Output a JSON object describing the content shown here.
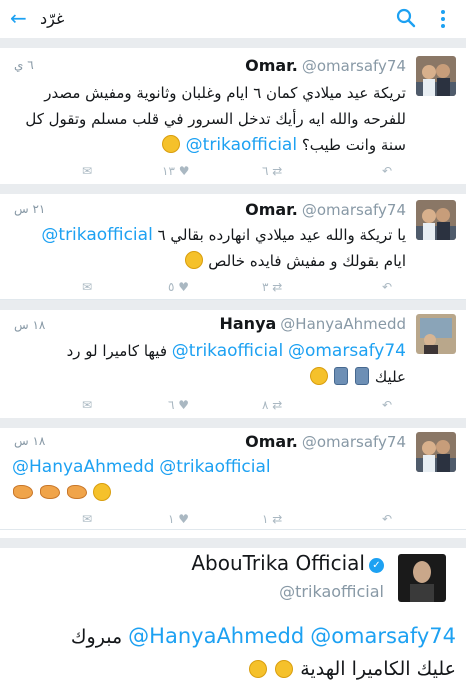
{
  "header": {
    "title": "غرّد"
  },
  "tweets": [
    {
      "name": "Omar.",
      "handle": "@omarsafy74",
      "time": "٦ ي",
      "line1": "تريكة عيد ميلادي كمان ٦ ايام وغلبان وثانوية ومفيش مصدر",
      "line2": "للفرحه والله ايه رأيك تدخل السرور في قلب مسلم وتقول كل",
      "line3": "سنة وانت طيب؟",
      "mention": "@trikaofficial",
      "reply": "",
      "retweets": "٦",
      "likes": "١٣"
    },
    {
      "name": "Omar.",
      "handle": "@omarsafy74",
      "time": "٢١ س",
      "line1": "يا تريكة والله عيد ميلادي انهارده بقالي ٦",
      "mention": "@trikaofficial",
      "line2": "ايام بقولك و مفيش فايده خالص",
      "retweets": "٣",
      "likes": "٥"
    },
    {
      "name": "Hanya",
      "handle": "@HanyaAhmedd",
      "time": "١٨ س",
      "mention1": "@omarsafy74",
      "mention2": "@trikaofficial",
      "line1": "فيها كاميرا لو رد",
      "line2": "عليك",
      "retweets": "٨",
      "likes": "٦"
    },
    {
      "name": "Omar.",
      "handle": "@omarsafy74",
      "time": "١٨ س",
      "mention1": "@HanyaAhmedd",
      "mention2": "@trikaofficial",
      "retweets": "١",
      "likes": "١"
    }
  ],
  "main_tweet": {
    "name": "AbouTrika Official",
    "handle": "@trikaofficial",
    "mention1": "@omarsafy74",
    "mention2": "@HanyaAhmedd",
    "word1": "مبروك",
    "line2": "عليك الكاميرا الهدية"
  },
  "colors": {
    "accent": "#1da1f2",
    "muted": "#8899a6",
    "divider": "#e1e8ed"
  }
}
